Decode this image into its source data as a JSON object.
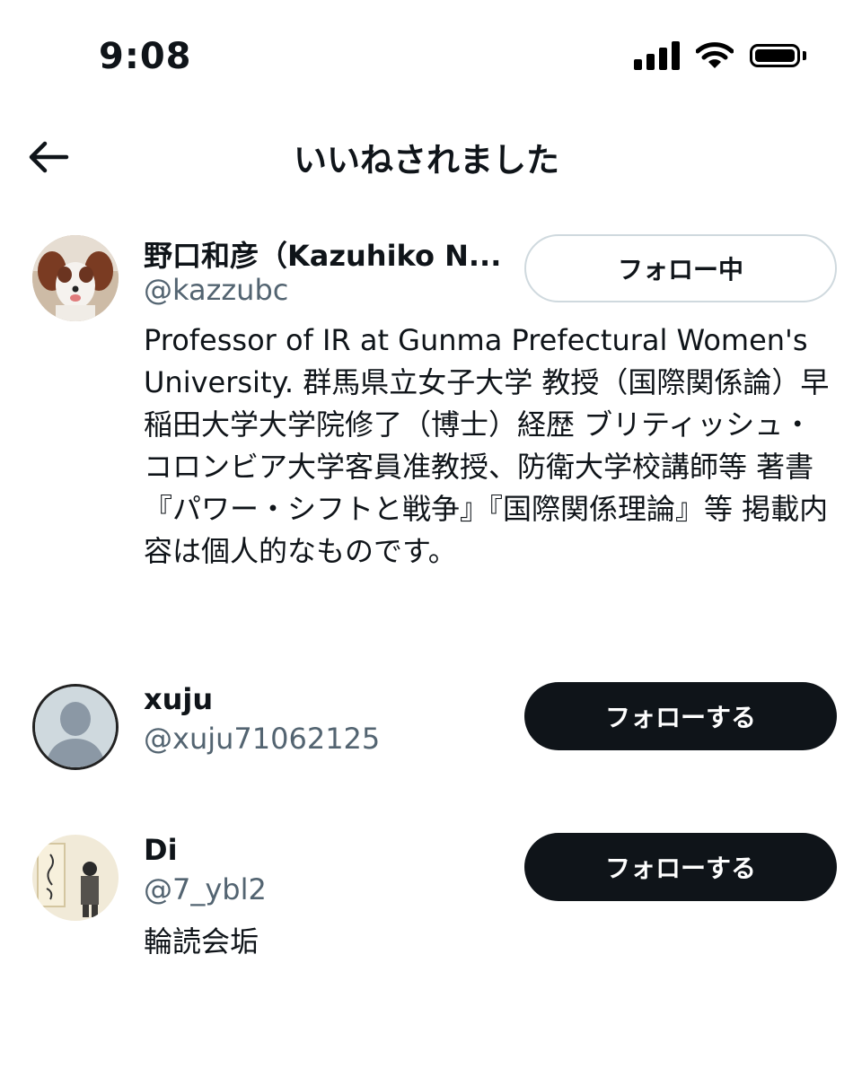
{
  "status_bar": {
    "time": "9:08"
  },
  "header": {
    "title": "いいねされました"
  },
  "users": [
    {
      "display_name": "野口和彦（Kazuhiko N...",
      "handle": "@kazzubc",
      "button_label": "フォロー中",
      "bio": "Professor of IR at Gunma Prefectural Women's University. 群馬県立女子大学 教授（国際関係論）早稲田大学大学院修了（博士）経歴 ブリティッシュ・コロンビア大学客員准教授、防衛大学校講師等 著書『パワー・シフトと戦争』『国際関係理論』等 掲載内容は個人的なものです。"
    },
    {
      "display_name": "xuju",
      "handle": "@xuju71062125",
      "button_label": "フォローする",
      "bio": ""
    },
    {
      "display_name": "Di",
      "handle": "@7_ybl2",
      "button_label": "フォローする",
      "bio": "輪読会垢"
    }
  ],
  "colors": {
    "text": "#0f1419",
    "secondary": "#536471",
    "button_dark": "#0f1419",
    "border": "#cfd9de"
  }
}
